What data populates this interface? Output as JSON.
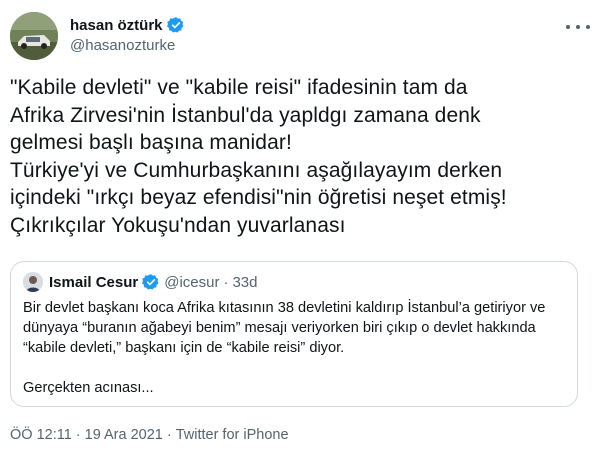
{
  "author": {
    "display_name": "hasan öztürk",
    "handle": "@hasanozturke",
    "verified_icon": "verified-badge-icon",
    "avatar_icon": "avatar-photo"
  },
  "tweet": {
    "lines": [
      "\"Kabile devleti\" ve \"kabile reisi\" ifadesinin tam da",
      "Afrika Zirvesi'nin İstanbul'da yapldgı zamana denk",
      "gelmesi başlı başına manidar!",
      "Türkiye'yi ve Cumhurbaşkanını aşağılayayım derken",
      "içindeki \"ırkçı beyaz efendisi\"nin  öğretisi neşet etmiş!",
      "Çıkrıkçılar Yokuşu'ndan yuvarlanası"
    ]
  },
  "quoted_tweet": {
    "display_name": "Ismail Cesur",
    "handle": "@icesur",
    "separator": "·",
    "time": "33d",
    "lines": [
      "Bir devlet başkanı koca Afrika kıtasının 38 devletini kaldırıp İstanbul’a getiriyor ve",
      "dünyaya “buranın ağabeyi benim” mesajı veriyorken biri çıkıp o devlet hakkında",
      "“kabile devleti,” başkanı için de “kabile reisi” diyor."
    ],
    "last_line": "Gerçekten acınası..."
  },
  "meta": {
    "time": "ÖÖ 12:11",
    "separator1": "·",
    "date": "19 Ara 2021",
    "separator2": "·",
    "source": "Twitter for iPhone"
  },
  "colors": {
    "verified": "#1d9bf0",
    "text": "#0f1419",
    "secondary": "#536471",
    "border": "#cfd9de"
  }
}
